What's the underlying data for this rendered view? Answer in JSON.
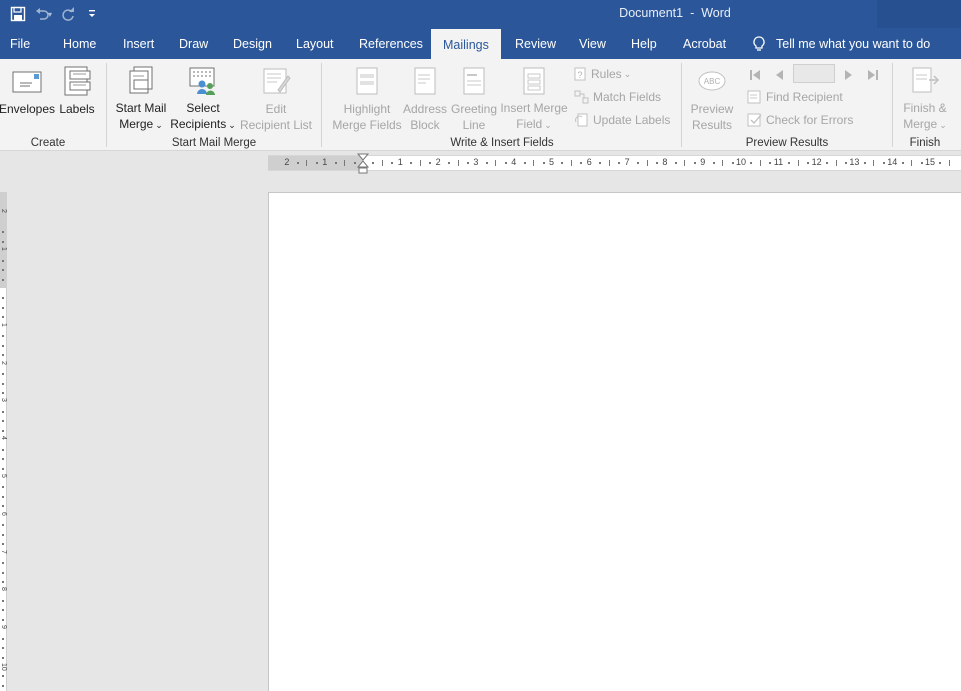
{
  "title": {
    "document": "Document1",
    "app": "Word",
    "separator": "-"
  },
  "quick_access": [
    {
      "icon": "save-icon",
      "enabled": true
    },
    {
      "icon": "undo-icon",
      "enabled": false
    },
    {
      "icon": "redo-icon",
      "enabled": false
    },
    {
      "icon": "customize-toolbar-icon",
      "enabled": true
    }
  ],
  "tabs": [
    "File",
    "Home",
    "Insert",
    "Draw",
    "Design",
    "Layout",
    "References",
    "Mailings",
    "Review",
    "View",
    "Help",
    "Acrobat"
  ],
  "active_tab": "Mailings",
  "tellme": "Tell me what you want to do",
  "ribbon": {
    "create": {
      "label": "Create",
      "envelopes": "Envelopes",
      "labels": "Labels"
    },
    "start_mail_merge": {
      "label": "Start Mail Merge",
      "start_line1": "Start Mail",
      "start_line2": "Merge",
      "select_line1": "Select",
      "select_line2": "Recipients",
      "edit_line1": "Edit",
      "edit_line2": "Recipient List"
    },
    "write_insert": {
      "label": "Write & Insert Fields",
      "highlight_line1": "Highlight",
      "highlight_line2": "Merge Fields",
      "address_line1": "Address",
      "address_line2": "Block",
      "greeting_line1": "Greeting",
      "greeting_line2": "Line",
      "insert_line1": "Insert Merge",
      "insert_line2": "Field",
      "rules": "Rules",
      "match_fields": "Match Fields",
      "update_labels": "Update Labels"
    },
    "preview": {
      "label": "Preview Results",
      "preview_line1": "Preview",
      "preview_line2": "Results",
      "find_recipient": "Find Recipient",
      "check_errors": "Check for Errors",
      "record_value": ""
    },
    "finish": {
      "label": "Finish",
      "finish_line1": "Finish &",
      "finish_line2": "Merge"
    }
  },
  "ruler": {
    "left_numbers": [
      "2",
      "1"
    ],
    "right_numbers": [
      "1",
      "2",
      "3",
      "4",
      "5",
      "6",
      "7",
      "8",
      "9",
      "10",
      "11",
      "12",
      "13",
      "14",
      "15"
    ],
    "vertical_numbers": [
      "2",
      "1",
      "1",
      "2",
      "3",
      "4",
      "5",
      "6",
      "7",
      "8",
      "9",
      "10"
    ]
  },
  "colors": {
    "brand": "#2b579a",
    "ribbon": "#f3f3f3",
    "canvas": "#e6e6e6",
    "disabled_text": "#a6a6a6"
  }
}
